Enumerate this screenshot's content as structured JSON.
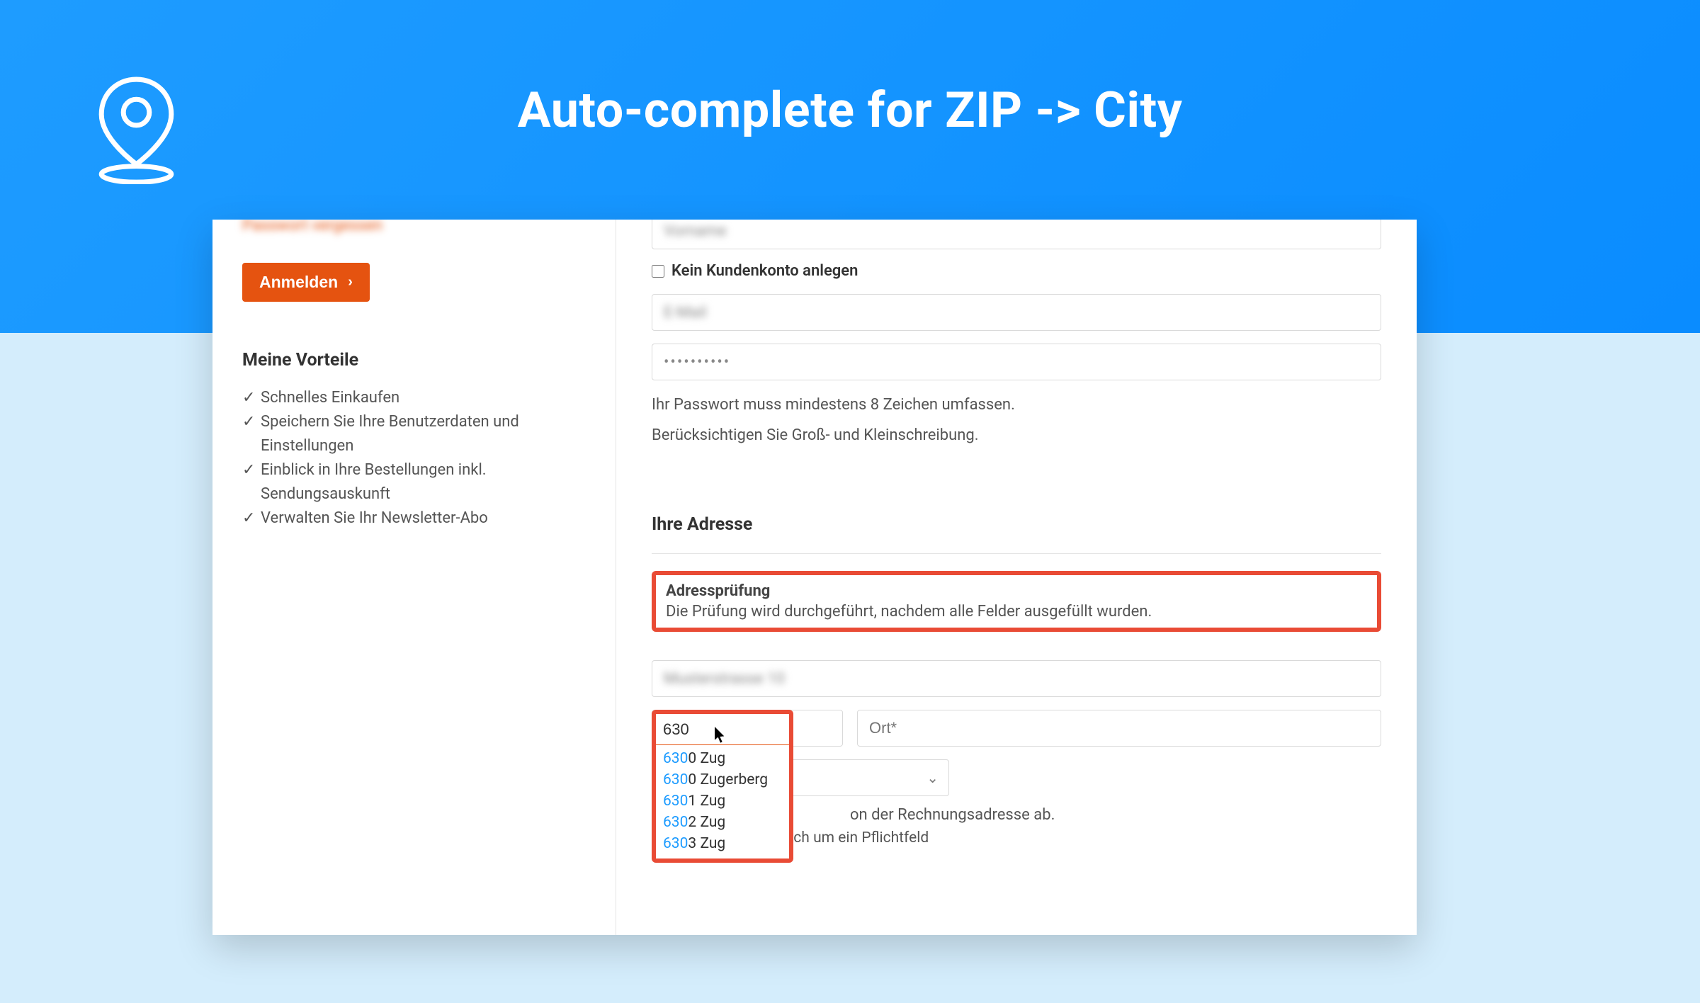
{
  "hero": {
    "title": "Auto-complete for ZIP -> City"
  },
  "sidebar": {
    "forgot_label": "Passwort vergessen",
    "login_label": "Anmelden",
    "benefits_title": "Meine Vorteile",
    "benefits": [
      "Schnelles Einkaufen",
      "Speichern Sie Ihre Benutzerdaten und Einstellungen",
      "Einblick in Ihre Bestellungen inkl. Sendungsauskunft",
      "Verwalten Sie Ihr Newsletter-Abo"
    ]
  },
  "form": {
    "field_blur_top": "Vorname",
    "no_account_label": "Kein Kundenkonto anlegen",
    "email_blur": "E-Mail",
    "password_mask": "••••••••••",
    "password_hint1": "Ihr Passwort muss mindestens 8 Zeichen umfassen.",
    "password_hint2": "Berücksichtigen Sie Groß- und Kleinschreibung.",
    "address_title": "Ihre Adresse",
    "callout_title": "Adressprüfung",
    "callout_text": "Die Prüfung wird durchgeführt, nachdem alle Felder ausgefüllt wurden.",
    "street_blur": "Musterstrasse 10",
    "zip_value": "630",
    "city_placeholder": "Ort*",
    "suggestions": [
      {
        "zip_hl": "630",
        "zip_rest": "0",
        "city": "Zug"
      },
      {
        "zip_hl": "630",
        "zip_rest": "0",
        "city": "Zugerberg"
      },
      {
        "zip_hl": "630",
        "zip_rest": "1",
        "city": "Zug"
      },
      {
        "zip_hl": "630",
        "zip_rest": "2",
        "city": "Zug"
      },
      {
        "zip_hl": "630",
        "zip_rest": "3",
        "city": "Zug"
      }
    ],
    "billing_note": "on der Rechnungsadresse ab.",
    "required_note": "* hierbei handelt es sich um ein Pflichtfeld"
  }
}
